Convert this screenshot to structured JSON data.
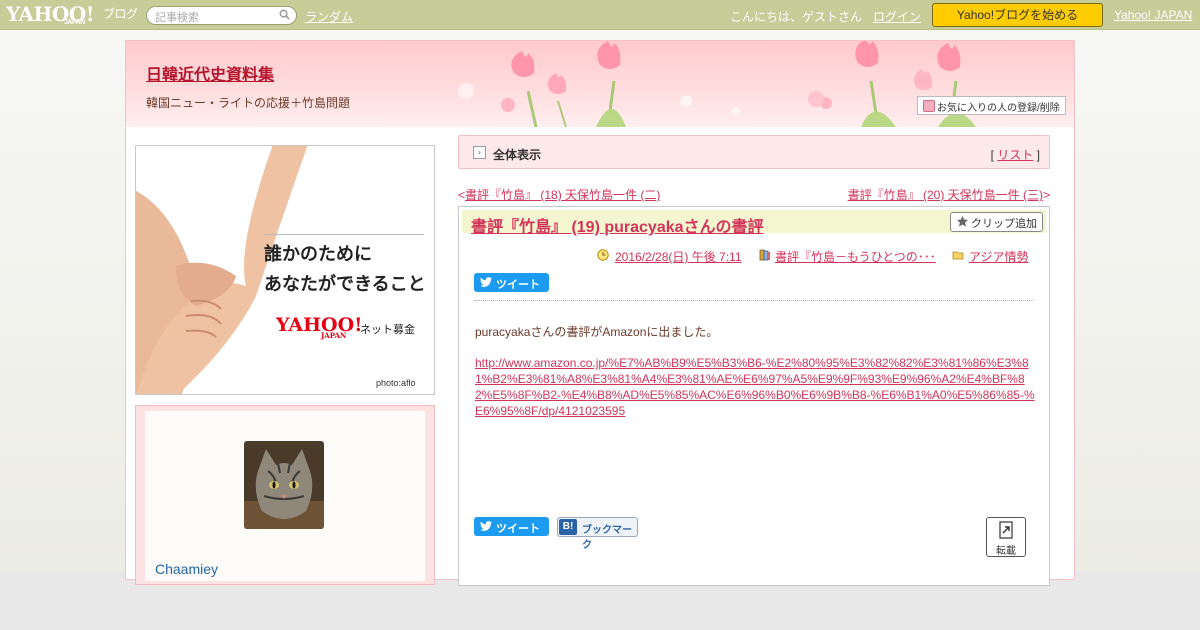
{
  "topbar": {
    "logo_text": "YAHOO!",
    "logo_sub": "JAPAN",
    "logo_blog": "ブログ",
    "search_placeholder": "記事検索",
    "random_link": "ランダム",
    "greeting": "こんにちは、ゲストさん",
    "login_link": "ログイン",
    "start_blog_button": "Yahoo!ブログを始める",
    "yahoo_japan_link": "Yahoo! JAPAN"
  },
  "blog": {
    "title": "日韓近代史資料集",
    "description": "韓国ニュー・ライトの応援＋竹島問題",
    "favorite_button": "お気に入りの人の登録/削除"
  },
  "ad": {
    "line1": "誰かのために",
    "line2": "あなたができること",
    "brand": "YAHOO!",
    "brand_sub": "JAPAN",
    "service": "ネット募金",
    "credit": "photo:aflo"
  },
  "profile": {
    "username": "Chaamiey"
  },
  "nav": {
    "label": "全体表示",
    "list_open": "[",
    "list_link": "リスト",
    "list_close": "]"
  },
  "pager": {
    "prev_marker": "<",
    "prev_link": "書評『竹島』 (18) 天保竹島一件 (二)",
    "next_link": "書評『竹島』 (20) 天保竹島一件 (三)",
    "next_marker": ">"
  },
  "article": {
    "title": "書評『竹島』 (19) puracyakaさんの書評",
    "clip_button": "クリップ追加",
    "date": "2016/2/28(日) 午後 7:11",
    "category": "書評『竹島－もうひとつの･･･",
    "folder": "アジア情勢",
    "tweet_button": "ツイート",
    "body_text": "puracyakaさんの書評がAmazonに出ました。",
    "body_link": "http://www.amazon.co.jp/%E7%AB%B9%E5%B3%B6-%E2%80%95%E3%82%82%E3%81%86%E3%81%B2%E3%81%A8%E3%81%A4%E3%81%AE%E6%97%A5%E9%9F%93%E9%96%A2%E4%BF%82%E5%8F%B2-%E4%B8%AD%E5%85%AC%E6%96%B0%E6%9B%B8-%E6%B1%A0%E5%86%85-%E6%95%8F/dp/4121023595",
    "tweet_button_bottom": "ツイート",
    "bookmark_button": "ブックマーク",
    "bookmark_icon": "B!",
    "reprint_button": "転載"
  },
  "colors": {
    "topbar": "#c6cd98",
    "link": "#d4345a",
    "title": "#b5152c",
    "start_button": "#ffcc00",
    "tweet": "#1d9bf0"
  }
}
